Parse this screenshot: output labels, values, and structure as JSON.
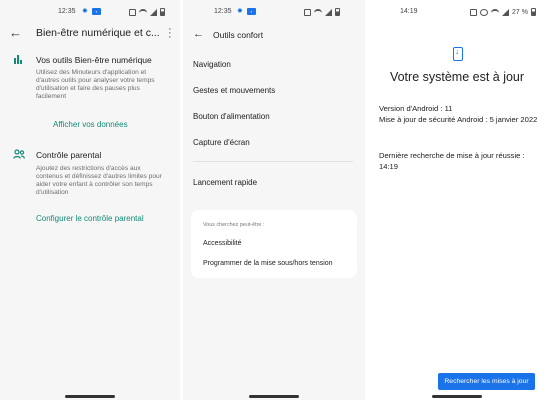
{
  "colors": {
    "accent_teal": "#128a78",
    "accent_blue": "#1a73e8",
    "background_gray": "#f6f6f6"
  },
  "panel1": {
    "status_time": "12:35",
    "toolbar_title": "Bien-être numérique et c...",
    "sections": [
      {
        "icon": "bar-chart-icon",
        "title": "Vos outils Bien-être numérique",
        "description": "Utilisez des Minuteurs d'application et d'autres outils pour analyser votre temps d'utilisation et faire des pauses plus facilement",
        "link": "Afficher vos données"
      },
      {
        "icon": "family-icon",
        "title": "Contrôle parental",
        "description": "Ajoutez des restrictions d'accès aux contenus et définissez d'autres limites pour aider votre enfant à contrôler son temps d'utilisation",
        "link": "Configurer le contrôle parental"
      }
    ]
  },
  "panel2": {
    "status_time": "12:35",
    "toolbar_title": "Outils confort",
    "menu": [
      "Navigation",
      "Gestes et mouvements",
      "Bouton d'alimentation",
      "Capture d'écran",
      "Lancement rapide"
    ],
    "suggestions": {
      "label": "Vous cherchez peut-être :",
      "items": [
        "Accessibilité",
        "Programmer de la mise sous/hors tension"
      ]
    }
  },
  "panel3": {
    "status_time": "14:19",
    "battery_text": "27 %",
    "title": "Votre système est à jour",
    "android_version": "Version d'Android : 11",
    "security_update": "Mise à jour de sécurité Android : 5 janvier 2022",
    "last_check": "Dernière recherche de mise à jour réussie : 14:19",
    "check_button": "Rechercher les mises à jour"
  }
}
